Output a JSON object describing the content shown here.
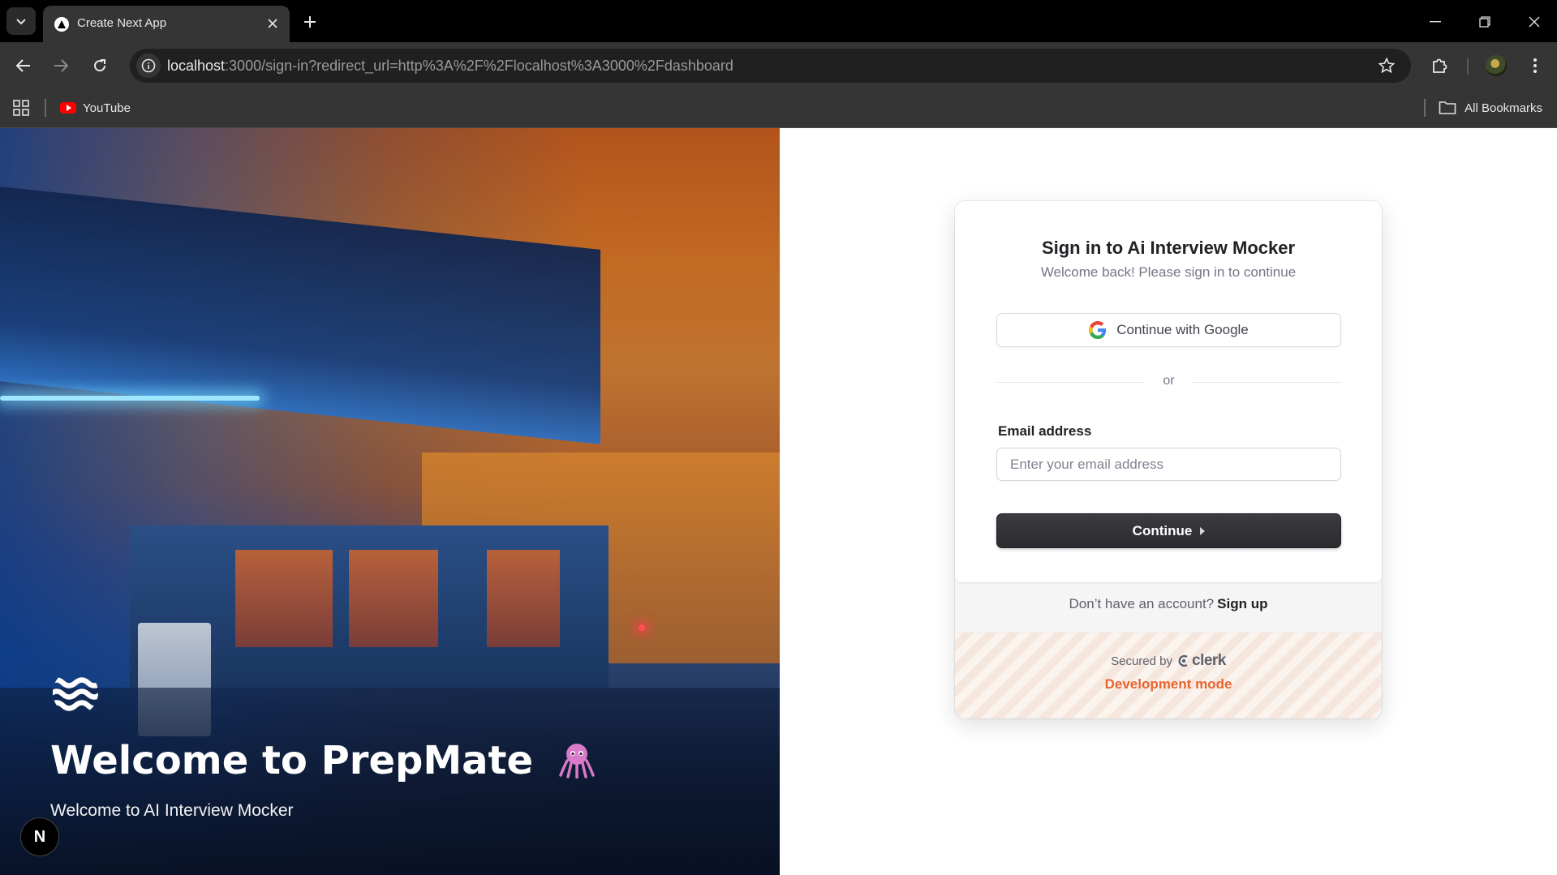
{
  "browser": {
    "tab_title": "Create Next App",
    "url_host": "localhost",
    "url_rest": ":3000/sign-in?redirect_url=http%3A%2F%2Flocalhost%3A3000%2Fdashboard",
    "bookmarks": {
      "youtube": "YouTube",
      "all_bookmarks": "All Bookmarks"
    }
  },
  "hero": {
    "title": "Welcome to PrepMate",
    "subtitle": "Welcome to AI Interview Mocker",
    "badge": "N"
  },
  "signin": {
    "title": "Sign in to Ai Interview Mocker",
    "subtitle": "Welcome back! Please sign in to continue",
    "google_label": "Continue with Google",
    "divider": "or",
    "email_label": "Email address",
    "email_placeholder": "Enter your email address",
    "email_value": "",
    "continue_label": "Continue",
    "no_account": "Don’t have an account?",
    "signup_link": "Sign up",
    "secured_by": "Secured by",
    "clerk": "clerk",
    "dev_mode": "Development mode"
  },
  "colors": {
    "dev_mode": "#e8652c",
    "primary_button": "#2f2f34"
  }
}
